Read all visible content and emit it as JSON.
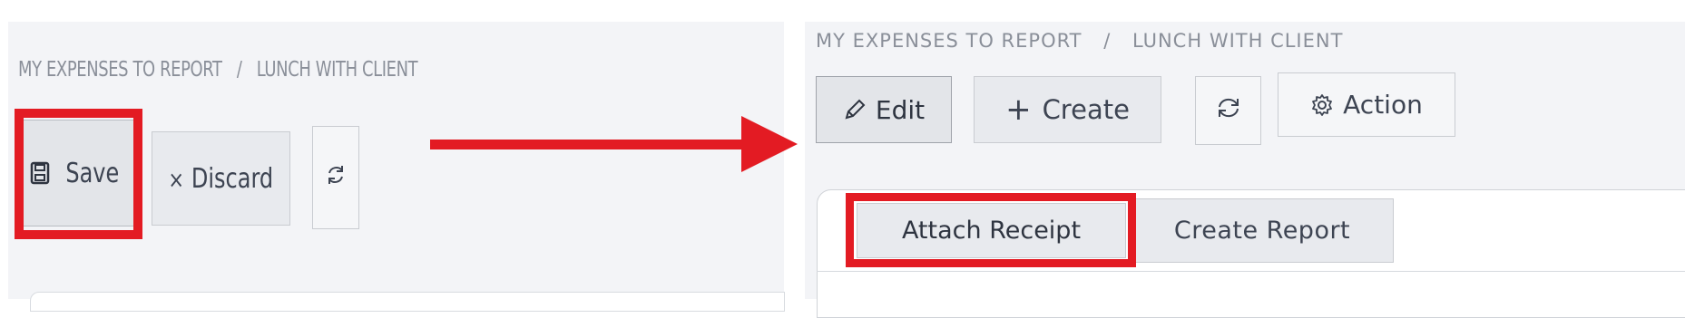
{
  "left": {
    "breadcrumb": {
      "parent": "MY EXPENSES TO REPORT",
      "separator": "/",
      "current": "LUNCH WITH CLIENT"
    },
    "buttons": {
      "save": "Save",
      "discard": "Discard",
      "discard_icon": "×"
    },
    "icons": {
      "save": "floppy-disk-icon",
      "refresh": "refresh-icon"
    }
  },
  "right": {
    "breadcrumb": {
      "parent": "MY EXPENSES TO REPORT",
      "separator": "/",
      "current": "LUNCH WITH CLIENT"
    },
    "buttons": {
      "edit": "Edit",
      "create": "Create",
      "create_icon": "+",
      "action": "Action",
      "attach_receipt": "Attach Receipt",
      "create_report": "Create Report"
    },
    "icons": {
      "edit": "pencil-icon",
      "refresh": "refresh-icon",
      "action": "gear-icon"
    }
  },
  "colors": {
    "highlight": "#e31b23",
    "arrow": "#e31b23",
    "panel_bg": "#f3f4f7",
    "text": "#3d4452"
  }
}
